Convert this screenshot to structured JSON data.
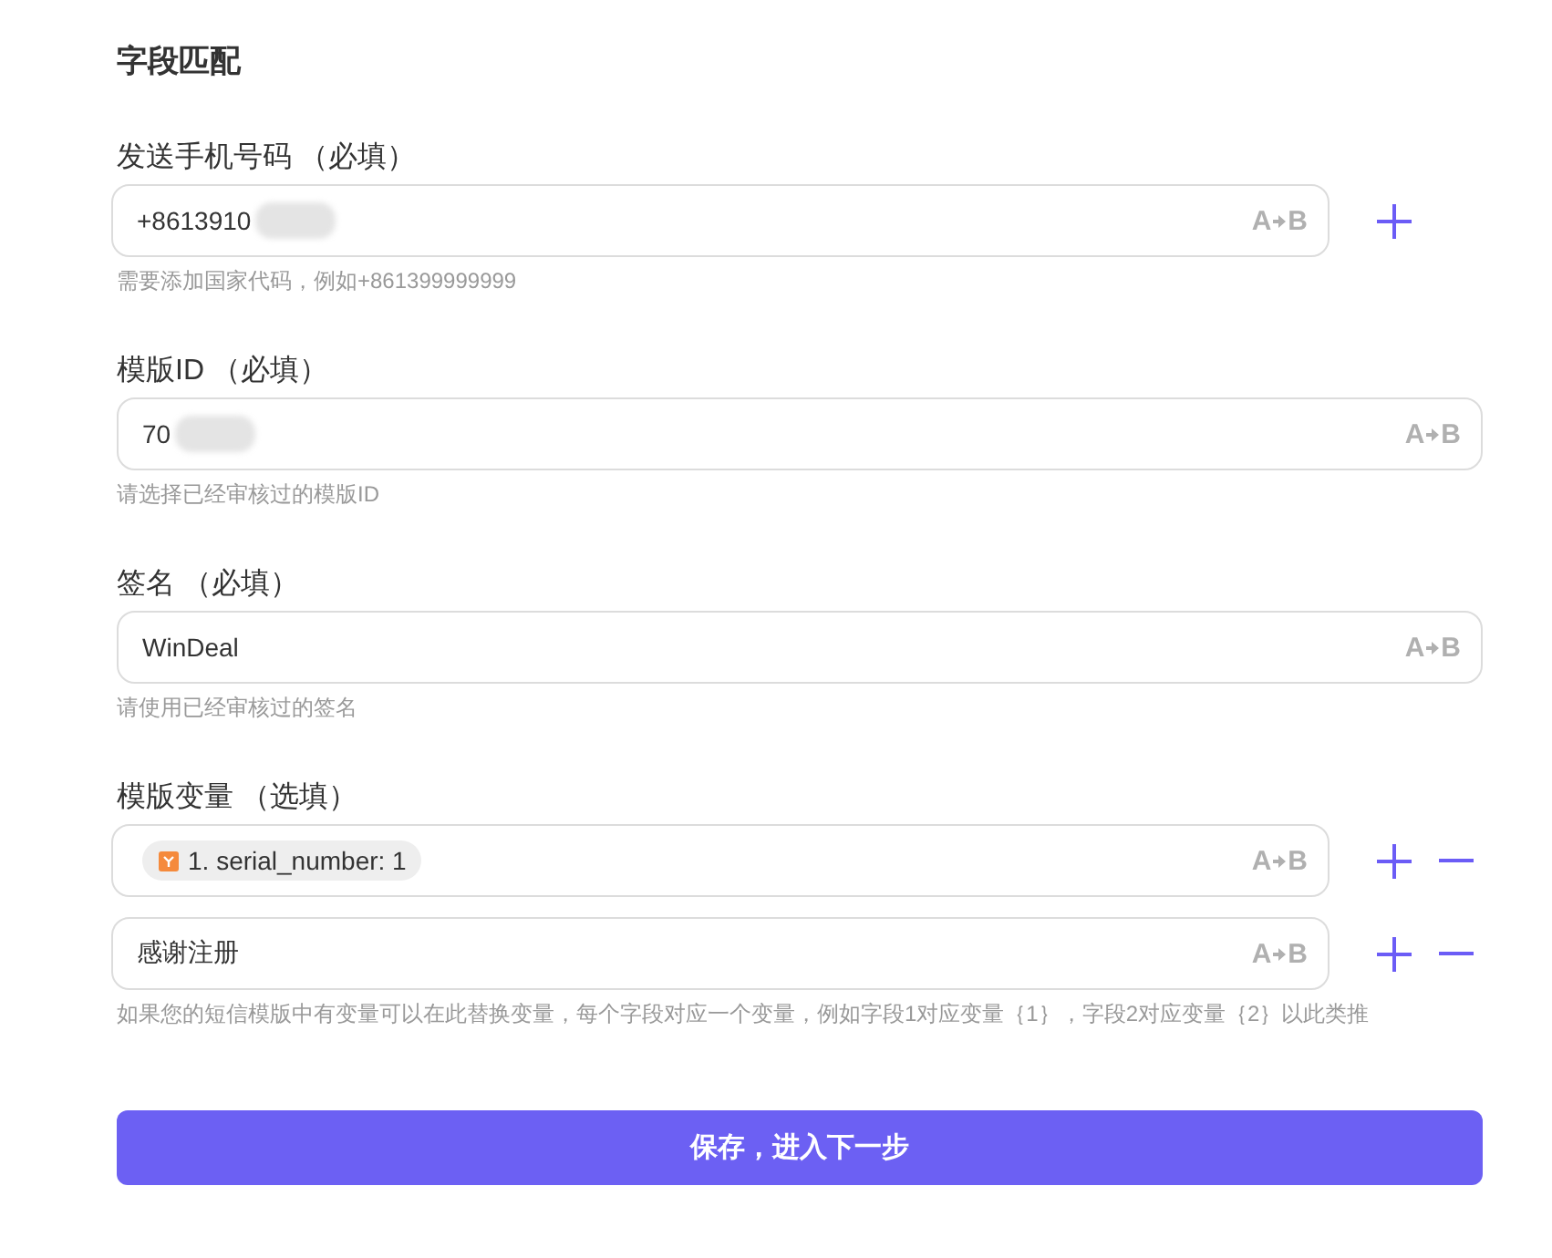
{
  "title": "字段匹配",
  "sections": [
    {
      "label": "发送手机号码",
      "requirement": "（必填）",
      "rows": [
        {
          "kind": "text",
          "value": "+8613910",
          "redacted": true,
          "mapping": {
            "from": "A",
            "to": "B"
          },
          "can_add": true
        }
      ],
      "hint": "需要添加国家代码，例如+861399999999"
    },
    {
      "label": "模版ID",
      "requirement": "（必填）",
      "rows": [
        {
          "kind": "text",
          "value": "70",
          "redacted": true,
          "mapping": {
            "from": "A",
            "to": "B"
          }
        }
      ],
      "hint": "请选择已经审核过的模版ID"
    },
    {
      "label": "签名",
      "requirement": "（必填）",
      "rows": [
        {
          "kind": "text",
          "value": "WinDeal",
          "redacted": false,
          "mapping": {
            "from": "A",
            "to": "B"
          }
        }
      ],
      "hint": "请使用已经审核过的签名"
    },
    {
      "label": "模版变量",
      "requirement": "（选填）",
      "rows": [
        {
          "kind": "chip",
          "value": "1. serial_number: 1",
          "redacted": false,
          "mapping": {
            "from": "A",
            "to": "B"
          },
          "can_add": true,
          "can_remove": true
        },
        {
          "kind": "text",
          "value": "感谢注册",
          "redacted": false,
          "mapping": {
            "from": "A",
            "to": "B"
          },
          "can_add": true,
          "can_remove": true
        }
      ],
      "hint": "如果您的短信模版中有变量可以在此替换变量，每个字段对应一个变量，例如字段1对应变量｛1｝，字段2对应变量｛2｝以此类推"
    }
  ],
  "submit_button": "保存，进入下一步"
}
